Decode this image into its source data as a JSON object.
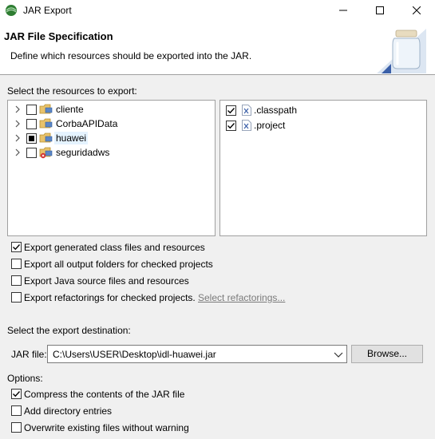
{
  "window": {
    "title": "JAR Export"
  },
  "banner": {
    "title": "JAR File Specification",
    "description": "Define which resources should be exported into the JAR."
  },
  "resources": {
    "label": "Select the resources to export:",
    "projects": [
      {
        "name": "cliente",
        "state": "unchecked"
      },
      {
        "name": "CorbaAPIData",
        "state": "unchecked"
      },
      {
        "name": "huawei",
        "state": "partial"
      },
      {
        "name": "seguridadws",
        "state": "unchecked"
      }
    ],
    "files": [
      {
        "name": ".classpath",
        "checked": true
      },
      {
        "name": ".project",
        "checked": true
      }
    ]
  },
  "export_options": {
    "class_files": {
      "label": "Export generated class files and resources",
      "checked": true
    },
    "output_folders": {
      "label": "Export all output folders for checked projects",
      "checked": false
    },
    "source_files": {
      "label": "Export Java source files and resources",
      "checked": false
    },
    "refactorings": {
      "label": "Export refactorings for checked projects.",
      "checked": false,
      "link": "Select refactorings..."
    }
  },
  "destination": {
    "label": "Select the export destination:",
    "jar_label": "JAR file:",
    "jar_value": "C:\\Users\\USER\\Desktop\\idl-huawei.jar",
    "browse_label": "Browse..."
  },
  "options": {
    "label": "Options:",
    "compress": {
      "label": "Compress the contents of the JAR file",
      "checked": true
    },
    "directory_entries": {
      "label": "Add directory entries",
      "checked": false
    },
    "overwrite": {
      "label": "Overwrite existing files without warning",
      "checked": false
    }
  },
  "colors": {
    "selection": "#e5f3ff",
    "link": "#7a7a7a",
    "banner_bg": "#ffffff",
    "dialog_bg": "#f0f0f0"
  }
}
